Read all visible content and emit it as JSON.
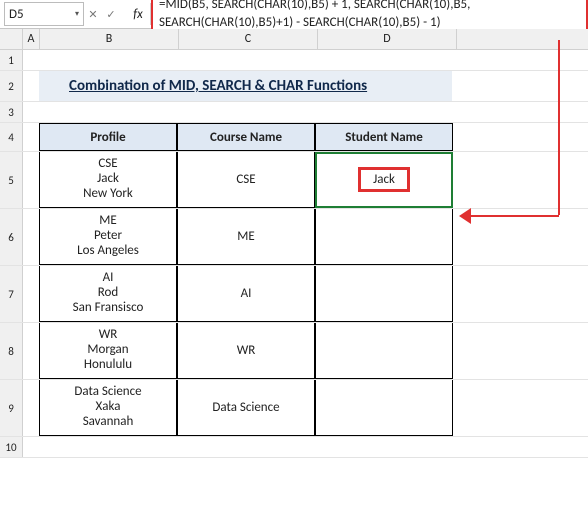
{
  "nameBox": "D5",
  "fxLabel": "fx",
  "formula": "=MID(B5, SEARCH(CHAR(10),B5) + 1, SEARCH(CHAR(10),B5, SEARCH(CHAR(10),B5)+1) - SEARCH(CHAR(10),B5) - 1)",
  "columns": {
    "A": "A",
    "B": "B",
    "C": "C",
    "D": "D"
  },
  "title": "Combination of MID, SEARCH & CHAR Functions",
  "headers": {
    "profile": "Profile",
    "course": "Course Name",
    "student": "Student Name"
  },
  "rows": [
    {
      "n": "1"
    },
    {
      "n": "2"
    },
    {
      "n": "3"
    },
    {
      "n": "4"
    },
    {
      "n": "5",
      "profile": [
        "CSE",
        "Jack",
        "New York"
      ],
      "course": "CSE",
      "student": "Jack"
    },
    {
      "n": "6",
      "profile": [
        "ME",
        "Peter",
        "Los Angeles"
      ],
      "course": "ME",
      "student": ""
    },
    {
      "n": "7",
      "profile": [
        "AI",
        "Rod",
        "San Fransisco"
      ],
      "course": "AI",
      "student": ""
    },
    {
      "n": "8",
      "profile": [
        "WR",
        "Morgan",
        "Honululu"
      ],
      "course": "WR",
      "student": ""
    },
    {
      "n": "9",
      "profile": [
        "Data Science",
        "Xaka",
        "Savannah"
      ],
      "course": "Data Science",
      "student": ""
    },
    {
      "n": "10"
    }
  ],
  "icons": {
    "cancel": "✕",
    "accept": "✓",
    "drop": "▾"
  }
}
